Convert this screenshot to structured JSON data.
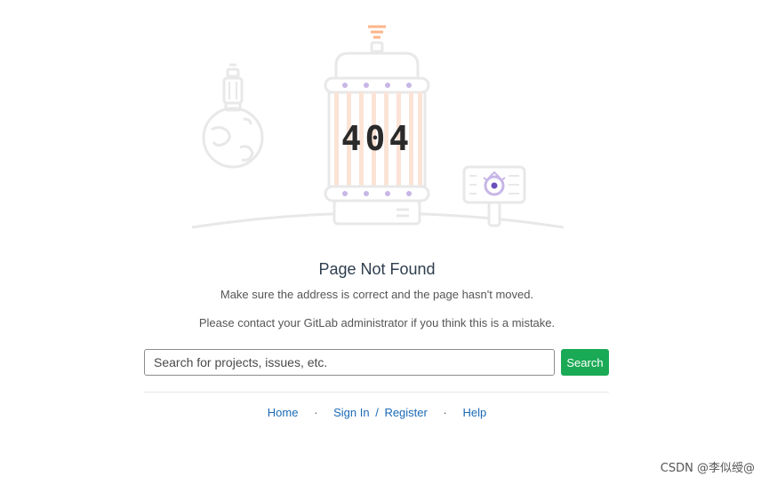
{
  "illustration": {
    "error_code": "404",
    "colors": {
      "outline": "#e8e8e8",
      "stripe": "#fbe3d6",
      "accent_orange": "#fcb58a",
      "accent_purple": "#c7b6e6",
      "eye_purple": "#6b4fbb"
    }
  },
  "page": {
    "title": "Page Not Found",
    "message_1": "Make sure the address is correct and the page hasn't moved.",
    "message_2": "Please contact your GitLab administrator if you think this is a mistake."
  },
  "search": {
    "placeholder": "Search for projects, issues, etc.",
    "value": "",
    "button_label": "Search"
  },
  "footer": {
    "home_label": "Home",
    "sign_in_label": "Sign In",
    "slash": "/",
    "register_label": "Register",
    "help_label": "Help",
    "separator": "·"
  },
  "watermark": {
    "text": "CSDN @李似绶@"
  },
  "colors": {
    "primary_button": "#1aaa55",
    "link": "#1b69b6",
    "title": "#2f3e4e"
  }
}
